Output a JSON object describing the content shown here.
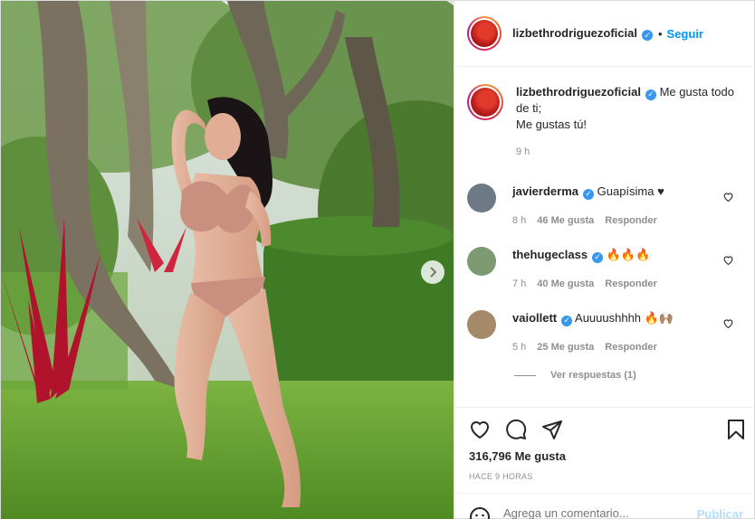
{
  "post": {
    "author": "lizbethrodriguezoficial",
    "follow_label": "Seguir",
    "dot": "•",
    "caption_line1": "Me gusta todo de ti;",
    "caption_line2": "Me gustas tú!",
    "caption_time": "9 h"
  },
  "comments": [
    {
      "user": "javierderma",
      "text": "Guapísima ♥",
      "time": "8 h",
      "likes": "46 Me gusta",
      "reply": "Responder",
      "avatar_color": "#6d7a86"
    },
    {
      "user": "thehugeclass",
      "text": "🔥🔥🔥",
      "time": "7 h",
      "likes": "40 Me gusta",
      "reply": "Responder",
      "avatar_color": "#7e9a73"
    },
    {
      "user": "vaiollett",
      "text": "Auuuushhhh 🔥🙌🏽",
      "time": "5 h",
      "likes": "25 Me gusta",
      "reply": "Responder",
      "avatar_color": "#a58a6a"
    }
  ],
  "replies_label": "Ver respuestas (1)",
  "actions": {
    "likes_count": "316,796 Me gusta",
    "posted_ago": "HACE 9 HORAS",
    "comment_placeholder": "Agrega un comentario...",
    "publish_label": "Publicar"
  },
  "icons": [
    "heart-icon",
    "comment-icon",
    "share-icon",
    "bookmark-icon",
    "emoji-icon",
    "chevron-right-icon",
    "verified-icon"
  ],
  "colors": {
    "accent": "#0095f6",
    "verified": "#3897f0",
    "muted": "#8e8e8e"
  }
}
